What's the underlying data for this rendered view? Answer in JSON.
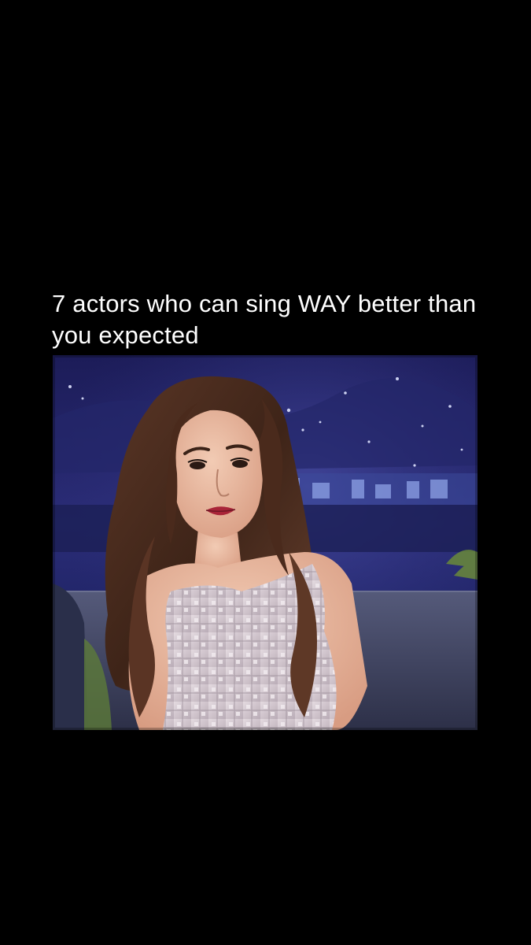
{
  "caption": {
    "text": "7 actors who can sing WAY better than you expected"
  },
  "video_frame": {
    "subject": "woman-on-talk-show-couch",
    "colors": {
      "backdrop_sky": "#2a2a6e",
      "backdrop_deep": "#14144a",
      "city_lights": "#7a8fd0",
      "couch": "#4a4f6e",
      "hair": "#4a2d1e",
      "skin": "#e9b9a0",
      "dress": "#d9cfd6",
      "lips": "#b0283a"
    }
  }
}
